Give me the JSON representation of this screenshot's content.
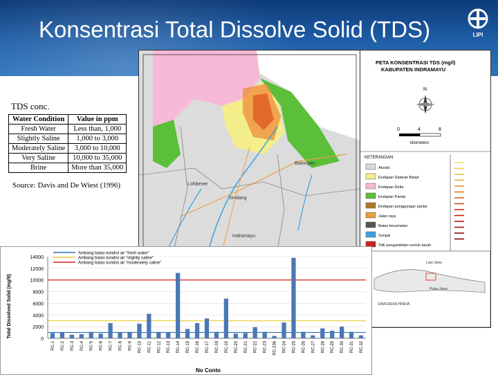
{
  "slide": {
    "title": "Konsentrasi Total Dissolve Solid (TDS)",
    "logo_text": "LIPI"
  },
  "table": {
    "label": "TDS conc.",
    "headers": [
      "Water Condition",
      "Value in ppm"
    ],
    "rows": [
      [
        "Fresh Water",
        "Less than, 1,000"
      ],
      [
        "Slightly Saline",
        "1,000 to 3,000"
      ],
      [
        "Moderately Saline",
        "3,000 to 10,000"
      ],
      [
        "Very Saline",
        "10,000 to 35,000"
      ],
      [
        "Brine",
        "More than 35,000"
      ]
    ],
    "source": "Source: Davis and De Wiest (1996)"
  },
  "map": {
    "title_line1": "PETA KONSENTRASI TDS (mg/l)",
    "title_line2": "KABUPATEN INDRAMAYU",
    "scale_ticks": [
      "0",
      "4",
      "8"
    ],
    "scale_unit": "kilometers",
    "legend_heading": "KETERANGAN",
    "legend_items": [
      {
        "label": "Aluvial",
        "color": "#d9d9d9"
      },
      {
        "label": "Endapan Dataran Banjir",
        "color": "#f3ee8a"
      },
      {
        "label": "Endapan Delta",
        "color": "#f6b9d6"
      },
      {
        "label": "Endapan Pantai",
        "color": "#5cbf3a"
      },
      {
        "label": "Endapan punggungan pantai",
        "color": "#b07a2a"
      },
      {
        "label": "Jalan raya",
        "color": "#e8a040"
      },
      {
        "label": "Batas kecamatan",
        "color": "#555555"
      },
      {
        "label": "Sungai",
        "color": "#3aa0e0"
      },
      {
        "label": "Titik pengambilan contoh tanah",
        "color": "#cc2222"
      }
    ],
    "place_labels": [
      "Lohbener",
      "Sindang",
      "Balongan",
      "Indramayu"
    ],
    "inset_labels": [
      "Laut Jawa",
      "Pulau Jawa",
      "SAMUDERA HINDIA"
    ]
  },
  "chart_data": {
    "type": "bar",
    "ylabel": "Total Dissolved Solid (mg/lt)",
    "xlabel": "No Conto",
    "ylim": [
      0,
      14000
    ],
    "yticks": [
      0,
      2000,
      4000,
      6000,
      8000,
      10000,
      12000,
      14000
    ],
    "ytick_labels": [
      "0",
      "2000",
      "4000",
      "6000",
      "8000",
      "10000",
      "12000",
      "14000"
    ],
    "categories": [
      "RC-1",
      "RC-2",
      "RC-3",
      "RC-4",
      "RC-5",
      "RC-6",
      "RC-7",
      "RC-8",
      "RC-9",
      "RC-10",
      "RC-11",
      "RC-12",
      "RC-13",
      "RC-14",
      "RC-15",
      "RC-16",
      "RC-17",
      "RC-18",
      "RC-19",
      "RC-20",
      "RC-21",
      "RC-22",
      "RC-23",
      "RC-23b",
      "RC-24",
      "RC-25",
      "RC-26",
      "RC-27",
      "RC-28",
      "RC-29",
      "RC-30",
      "RC-31",
      "RC-32"
    ],
    "values": [
      900,
      1000,
      600,
      700,
      1100,
      800,
      2600,
      1000,
      1100,
      2500,
      4200,
      1100,
      1000,
      11200,
      1600,
      2600,
      3400,
      1100,
      6800,
      800,
      900,
      1900,
      1100,
      400,
      2700,
      13800,
      1100,
      500,
      1700,
      1300,
      2000,
      1100,
      500
    ],
    "reference_lines": [
      {
        "name": "Ambang batas kondisi air \"fresh water\"",
        "value": 1000,
        "color": "#2f6fb0"
      },
      {
        "name": "Ambang batas kondisi air \"slightly saline\"",
        "value": 3000,
        "color": "#e8d040"
      },
      {
        "name": "Ambang batas kondisi air \"moderately saline\"",
        "value": 10000,
        "color": "#d02020"
      }
    ],
    "bar_color": "#4a78b4"
  }
}
